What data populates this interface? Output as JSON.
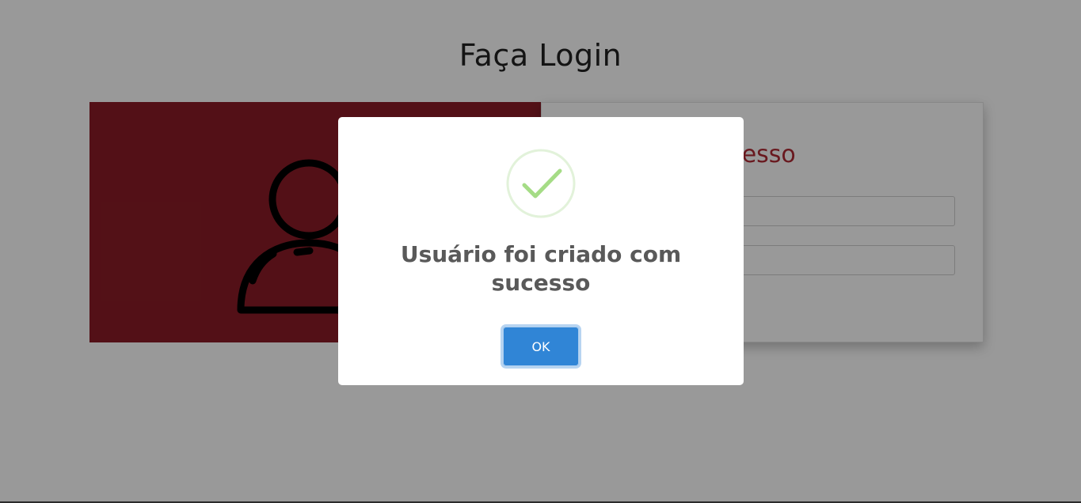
{
  "page": {
    "title": "Faça Login"
  },
  "login_card": {
    "heading_visible_fragment": "cesso",
    "username_value": "",
    "password_value": "",
    "accent_color": "#8b1c27",
    "heading_color": "#b02b35"
  },
  "illustration": {
    "icon": "user-icon"
  },
  "modal": {
    "icon": "success-check-icon",
    "message": "Usuário foi criado com sucesso",
    "ok_label": "OK",
    "button_color": "#3085d6",
    "check_color": "#a5dc86"
  }
}
